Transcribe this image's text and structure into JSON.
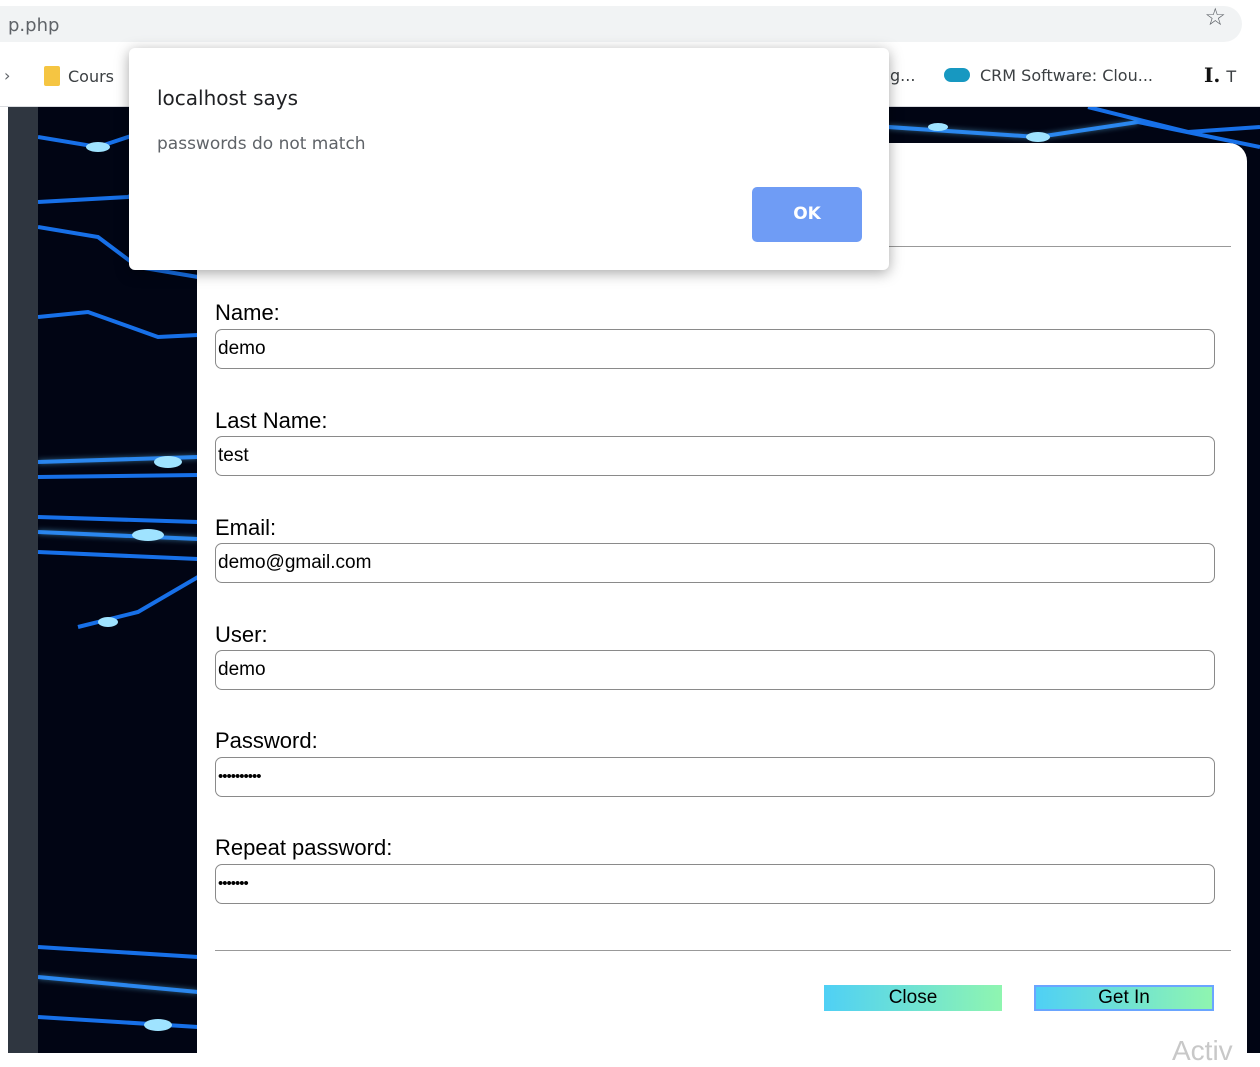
{
  "browser": {
    "url": "p.php",
    "bookmark_star_icon": "star-outline-icon"
  },
  "bookmarks": [
    {
      "label": "Cours",
      "icon": "folder-icon"
    },
    {
      "label": "g...",
      "icon": "none"
    },
    {
      "label": "CRM Software: Clou...",
      "icon": "salesforce-cloud-icon"
    },
    {
      "label": "T",
      "icon": "t-icon"
    }
  ],
  "alert": {
    "title": "localhost says",
    "message": "passwords do not match",
    "ok_label": "OK"
  },
  "form": {
    "fields": [
      {
        "label": "Name:",
        "value": "demo"
      },
      {
        "label": "Last Name:",
        "value": "test"
      },
      {
        "label": "Email:",
        "value": "demo@gmail.com"
      },
      {
        "label": "User:",
        "value": "demo"
      },
      {
        "label": "Password:",
        "value": "••••••••••"
      },
      {
        "label": "Repeat password:",
        "value": "•••••••"
      }
    ],
    "close_label": "Close",
    "getin_label": "Get In"
  },
  "watermark": "Activ",
  "colors": {
    "ok_button": "#6f9cf5",
    "button_gradient_start": "#4fd0f5",
    "button_gradient_end": "#8ff5b0",
    "background": "#010514"
  }
}
